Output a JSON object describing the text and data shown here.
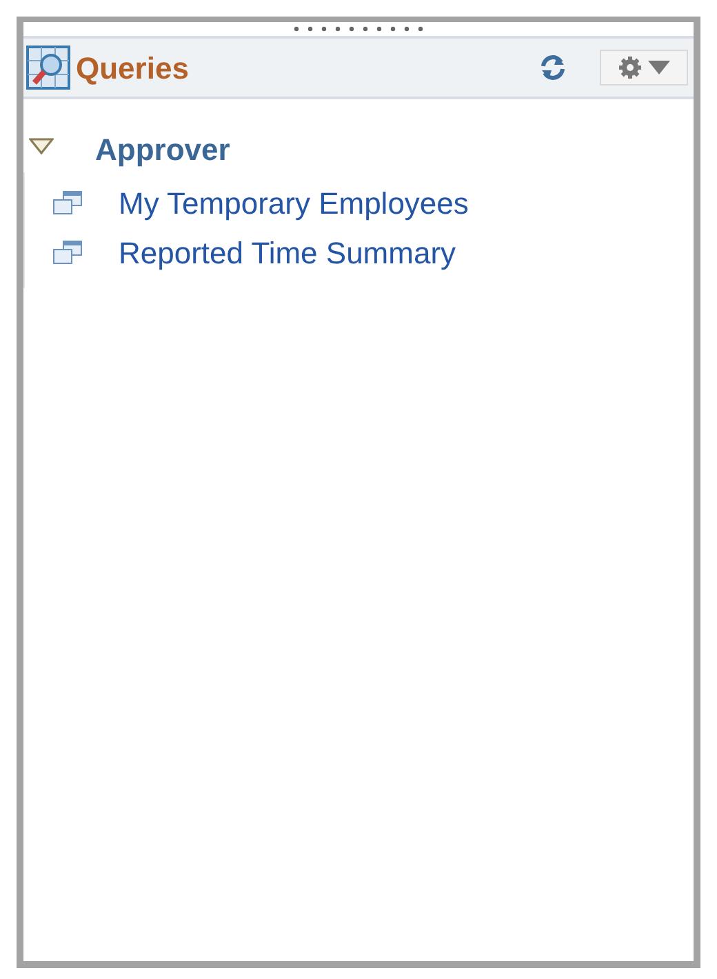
{
  "pagelet": {
    "title": "Queries"
  },
  "tree": [
    {
      "label": "Approver",
      "expanded": true,
      "children": [
        {
          "label": "My Temporary Employees"
        },
        {
          "label": "Reported Time Summary"
        }
      ]
    }
  ]
}
